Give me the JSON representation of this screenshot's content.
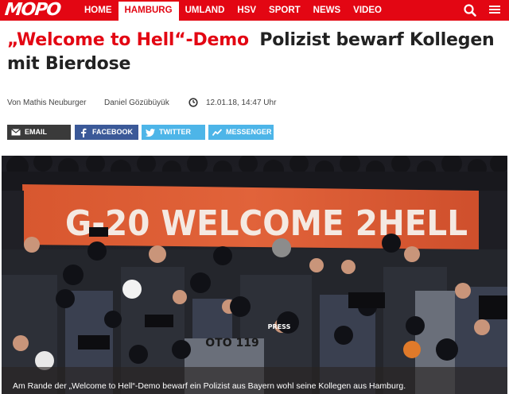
{
  "brand": {
    "logo_text": "MOPO",
    "color": "#e30613"
  },
  "nav": {
    "items": [
      {
        "label": "HOME",
        "active": false
      },
      {
        "label": "HAMBURG",
        "active": true
      },
      {
        "label": "UMLAND",
        "active": false
      },
      {
        "label": "HSV",
        "active": false
      },
      {
        "label": "SPORT",
        "active": false
      },
      {
        "label": "NEWS",
        "active": false
      },
      {
        "label": "VIDEO",
        "active": false
      }
    ],
    "search_icon": "search-icon",
    "menu_icon": "hamburger-menu-icon"
  },
  "article": {
    "kicker": "„Welcome to Hell“-Demo",
    "title": "Polizist bewarf Kollegen mit Bierdose",
    "author1": "Von Mathis Neuburger",
    "author2": "Daniel Gözübüyük",
    "date": "12.01.18, 14:47 Uhr"
  },
  "share": {
    "email": "EMAIL",
    "facebook": "FACEBOOK",
    "twitter": "TWITTER",
    "messenger": "MESSENGER"
  },
  "photo": {
    "banner_text": "G-20 WELCOME 2HELL",
    "helmet_label": "PRESS",
    "shirt_label": "OTO 119",
    "caption": "Am Rande der „Welcome to Hell“-Demo bewarf ein Polizist aus Bayern wohl seine Kollegen aus Hamburg."
  }
}
